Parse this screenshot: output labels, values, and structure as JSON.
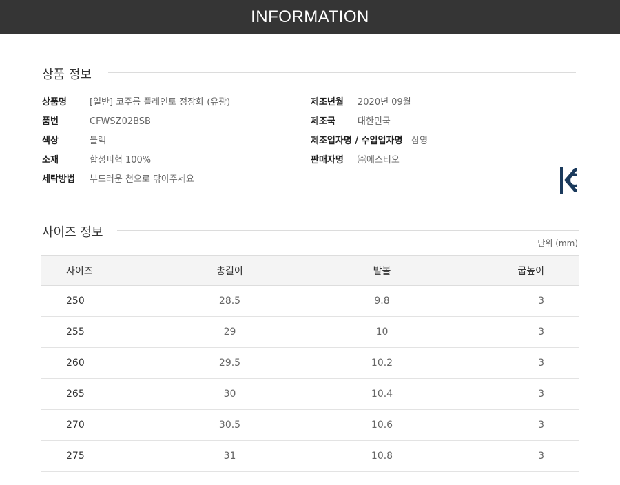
{
  "banner": {
    "title": "INFORMATION"
  },
  "product_section": {
    "title": "상품 정보",
    "left_rows": [
      {
        "label": "상품명",
        "value": "[일반] 코주름 플레인토 정장화 (유광)"
      },
      {
        "label": "품번",
        "value": "CFWSZ02BSB"
      },
      {
        "label": "색상",
        "value": "블랙"
      },
      {
        "label": "소재",
        "value": "합성피혁 100%"
      },
      {
        "label": "세탁방법",
        "value": "부드러운 천으로 닦아주세요"
      }
    ],
    "right_rows": [
      {
        "label": "제조년월",
        "value": "2020년 09월"
      },
      {
        "label": "제조국",
        "value": "대한민국"
      },
      {
        "label": "제조업자명 / 수입업자명",
        "value": "삼영"
      },
      {
        "label": "판매자명",
        "value": "㈜에스티오"
      }
    ],
    "certification_icon": "kc-mark-icon",
    "certification_color": "#1b3a5c"
  },
  "size_section": {
    "title": "사이즈 정보",
    "unit": "단위 (mm)",
    "columns": [
      "사이즈",
      "총길이",
      "발볼",
      "굽높이"
    ],
    "rows": [
      [
        "250",
        "28.5",
        "9.8",
        "3"
      ],
      [
        "255",
        "29",
        "10",
        "3"
      ],
      [
        "260",
        "29.5",
        "10.2",
        "3"
      ],
      [
        "265",
        "30",
        "10.4",
        "3"
      ],
      [
        "270",
        "30.5",
        "10.6",
        "3"
      ],
      [
        "275",
        "31",
        "10.8",
        "3"
      ]
    ]
  }
}
